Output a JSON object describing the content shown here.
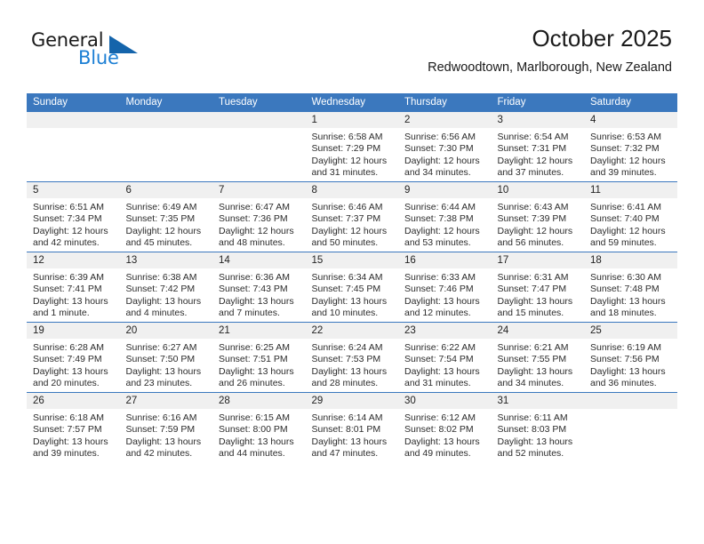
{
  "brand": {
    "name_part1": "General",
    "name_part2": "Blue"
  },
  "header": {
    "title": "October 2025",
    "subtitle": "Redwoodtown, Marlborough, New Zealand"
  },
  "colors": {
    "header_blue": "#3b78be",
    "logo_blue": "#1c7fd4",
    "daynum_bg": "#f0f0f0"
  },
  "weekday_headers": [
    "Sunday",
    "Monday",
    "Tuesday",
    "Wednesday",
    "Thursday",
    "Friday",
    "Saturday"
  ],
  "weeks": [
    [
      {
        "day": "",
        "empty": true,
        "sunrise": "",
        "sunset": "",
        "daylight1": "",
        "daylight2": ""
      },
      {
        "day": "",
        "empty": true,
        "sunrise": "",
        "sunset": "",
        "daylight1": "",
        "daylight2": ""
      },
      {
        "day": "",
        "empty": true,
        "sunrise": "",
        "sunset": "",
        "daylight1": "",
        "daylight2": ""
      },
      {
        "day": "1",
        "empty": false,
        "sunrise": "Sunrise: 6:58 AM",
        "sunset": "Sunset: 7:29 PM",
        "daylight1": "Daylight: 12 hours",
        "daylight2": "and 31 minutes."
      },
      {
        "day": "2",
        "empty": false,
        "sunrise": "Sunrise: 6:56 AM",
        "sunset": "Sunset: 7:30 PM",
        "daylight1": "Daylight: 12 hours",
        "daylight2": "and 34 minutes."
      },
      {
        "day": "3",
        "empty": false,
        "sunrise": "Sunrise: 6:54 AM",
        "sunset": "Sunset: 7:31 PM",
        "daylight1": "Daylight: 12 hours",
        "daylight2": "and 37 minutes."
      },
      {
        "day": "4",
        "empty": false,
        "sunrise": "Sunrise: 6:53 AM",
        "sunset": "Sunset: 7:32 PM",
        "daylight1": "Daylight: 12 hours",
        "daylight2": "and 39 minutes."
      }
    ],
    [
      {
        "day": "5",
        "empty": false,
        "sunrise": "Sunrise: 6:51 AM",
        "sunset": "Sunset: 7:34 PM",
        "daylight1": "Daylight: 12 hours",
        "daylight2": "and 42 minutes."
      },
      {
        "day": "6",
        "empty": false,
        "sunrise": "Sunrise: 6:49 AM",
        "sunset": "Sunset: 7:35 PM",
        "daylight1": "Daylight: 12 hours",
        "daylight2": "and 45 minutes."
      },
      {
        "day": "7",
        "empty": false,
        "sunrise": "Sunrise: 6:47 AM",
        "sunset": "Sunset: 7:36 PM",
        "daylight1": "Daylight: 12 hours",
        "daylight2": "and 48 minutes."
      },
      {
        "day": "8",
        "empty": false,
        "sunrise": "Sunrise: 6:46 AM",
        "sunset": "Sunset: 7:37 PM",
        "daylight1": "Daylight: 12 hours",
        "daylight2": "and 50 minutes."
      },
      {
        "day": "9",
        "empty": false,
        "sunrise": "Sunrise: 6:44 AM",
        "sunset": "Sunset: 7:38 PM",
        "daylight1": "Daylight: 12 hours",
        "daylight2": "and 53 minutes."
      },
      {
        "day": "10",
        "empty": false,
        "sunrise": "Sunrise: 6:43 AM",
        "sunset": "Sunset: 7:39 PM",
        "daylight1": "Daylight: 12 hours",
        "daylight2": "and 56 minutes."
      },
      {
        "day": "11",
        "empty": false,
        "sunrise": "Sunrise: 6:41 AM",
        "sunset": "Sunset: 7:40 PM",
        "daylight1": "Daylight: 12 hours",
        "daylight2": "and 59 minutes."
      }
    ],
    [
      {
        "day": "12",
        "empty": false,
        "sunrise": "Sunrise: 6:39 AM",
        "sunset": "Sunset: 7:41 PM",
        "daylight1": "Daylight: 13 hours",
        "daylight2": "and 1 minute."
      },
      {
        "day": "13",
        "empty": false,
        "sunrise": "Sunrise: 6:38 AM",
        "sunset": "Sunset: 7:42 PM",
        "daylight1": "Daylight: 13 hours",
        "daylight2": "and 4 minutes."
      },
      {
        "day": "14",
        "empty": false,
        "sunrise": "Sunrise: 6:36 AM",
        "sunset": "Sunset: 7:43 PM",
        "daylight1": "Daylight: 13 hours",
        "daylight2": "and 7 minutes."
      },
      {
        "day": "15",
        "empty": false,
        "sunrise": "Sunrise: 6:34 AM",
        "sunset": "Sunset: 7:45 PM",
        "daylight1": "Daylight: 13 hours",
        "daylight2": "and 10 minutes."
      },
      {
        "day": "16",
        "empty": false,
        "sunrise": "Sunrise: 6:33 AM",
        "sunset": "Sunset: 7:46 PM",
        "daylight1": "Daylight: 13 hours",
        "daylight2": "and 12 minutes."
      },
      {
        "day": "17",
        "empty": false,
        "sunrise": "Sunrise: 6:31 AM",
        "sunset": "Sunset: 7:47 PM",
        "daylight1": "Daylight: 13 hours",
        "daylight2": "and 15 minutes."
      },
      {
        "day": "18",
        "empty": false,
        "sunrise": "Sunrise: 6:30 AM",
        "sunset": "Sunset: 7:48 PM",
        "daylight1": "Daylight: 13 hours",
        "daylight2": "and 18 minutes."
      }
    ],
    [
      {
        "day": "19",
        "empty": false,
        "sunrise": "Sunrise: 6:28 AM",
        "sunset": "Sunset: 7:49 PM",
        "daylight1": "Daylight: 13 hours",
        "daylight2": "and 20 minutes."
      },
      {
        "day": "20",
        "empty": false,
        "sunrise": "Sunrise: 6:27 AM",
        "sunset": "Sunset: 7:50 PM",
        "daylight1": "Daylight: 13 hours",
        "daylight2": "and 23 minutes."
      },
      {
        "day": "21",
        "empty": false,
        "sunrise": "Sunrise: 6:25 AM",
        "sunset": "Sunset: 7:51 PM",
        "daylight1": "Daylight: 13 hours",
        "daylight2": "and 26 minutes."
      },
      {
        "day": "22",
        "empty": false,
        "sunrise": "Sunrise: 6:24 AM",
        "sunset": "Sunset: 7:53 PM",
        "daylight1": "Daylight: 13 hours",
        "daylight2": "and 28 minutes."
      },
      {
        "day": "23",
        "empty": false,
        "sunrise": "Sunrise: 6:22 AM",
        "sunset": "Sunset: 7:54 PM",
        "daylight1": "Daylight: 13 hours",
        "daylight2": "and 31 minutes."
      },
      {
        "day": "24",
        "empty": false,
        "sunrise": "Sunrise: 6:21 AM",
        "sunset": "Sunset: 7:55 PM",
        "daylight1": "Daylight: 13 hours",
        "daylight2": "and 34 minutes."
      },
      {
        "day": "25",
        "empty": false,
        "sunrise": "Sunrise: 6:19 AM",
        "sunset": "Sunset: 7:56 PM",
        "daylight1": "Daylight: 13 hours",
        "daylight2": "and 36 minutes."
      }
    ],
    [
      {
        "day": "26",
        "empty": false,
        "sunrise": "Sunrise: 6:18 AM",
        "sunset": "Sunset: 7:57 PM",
        "daylight1": "Daylight: 13 hours",
        "daylight2": "and 39 minutes."
      },
      {
        "day": "27",
        "empty": false,
        "sunrise": "Sunrise: 6:16 AM",
        "sunset": "Sunset: 7:59 PM",
        "daylight1": "Daylight: 13 hours",
        "daylight2": "and 42 minutes."
      },
      {
        "day": "28",
        "empty": false,
        "sunrise": "Sunrise: 6:15 AM",
        "sunset": "Sunset: 8:00 PM",
        "daylight1": "Daylight: 13 hours",
        "daylight2": "and 44 minutes."
      },
      {
        "day": "29",
        "empty": false,
        "sunrise": "Sunrise: 6:14 AM",
        "sunset": "Sunset: 8:01 PM",
        "daylight1": "Daylight: 13 hours",
        "daylight2": "and 47 minutes."
      },
      {
        "day": "30",
        "empty": false,
        "sunrise": "Sunrise: 6:12 AM",
        "sunset": "Sunset: 8:02 PM",
        "daylight1": "Daylight: 13 hours",
        "daylight2": "and 49 minutes."
      },
      {
        "day": "31",
        "empty": false,
        "sunrise": "Sunrise: 6:11 AM",
        "sunset": "Sunset: 8:03 PM",
        "daylight1": "Daylight: 13 hours",
        "daylight2": "and 52 minutes."
      },
      {
        "day": "",
        "empty": true,
        "sunrise": "",
        "sunset": "",
        "daylight1": "",
        "daylight2": ""
      }
    ]
  ]
}
